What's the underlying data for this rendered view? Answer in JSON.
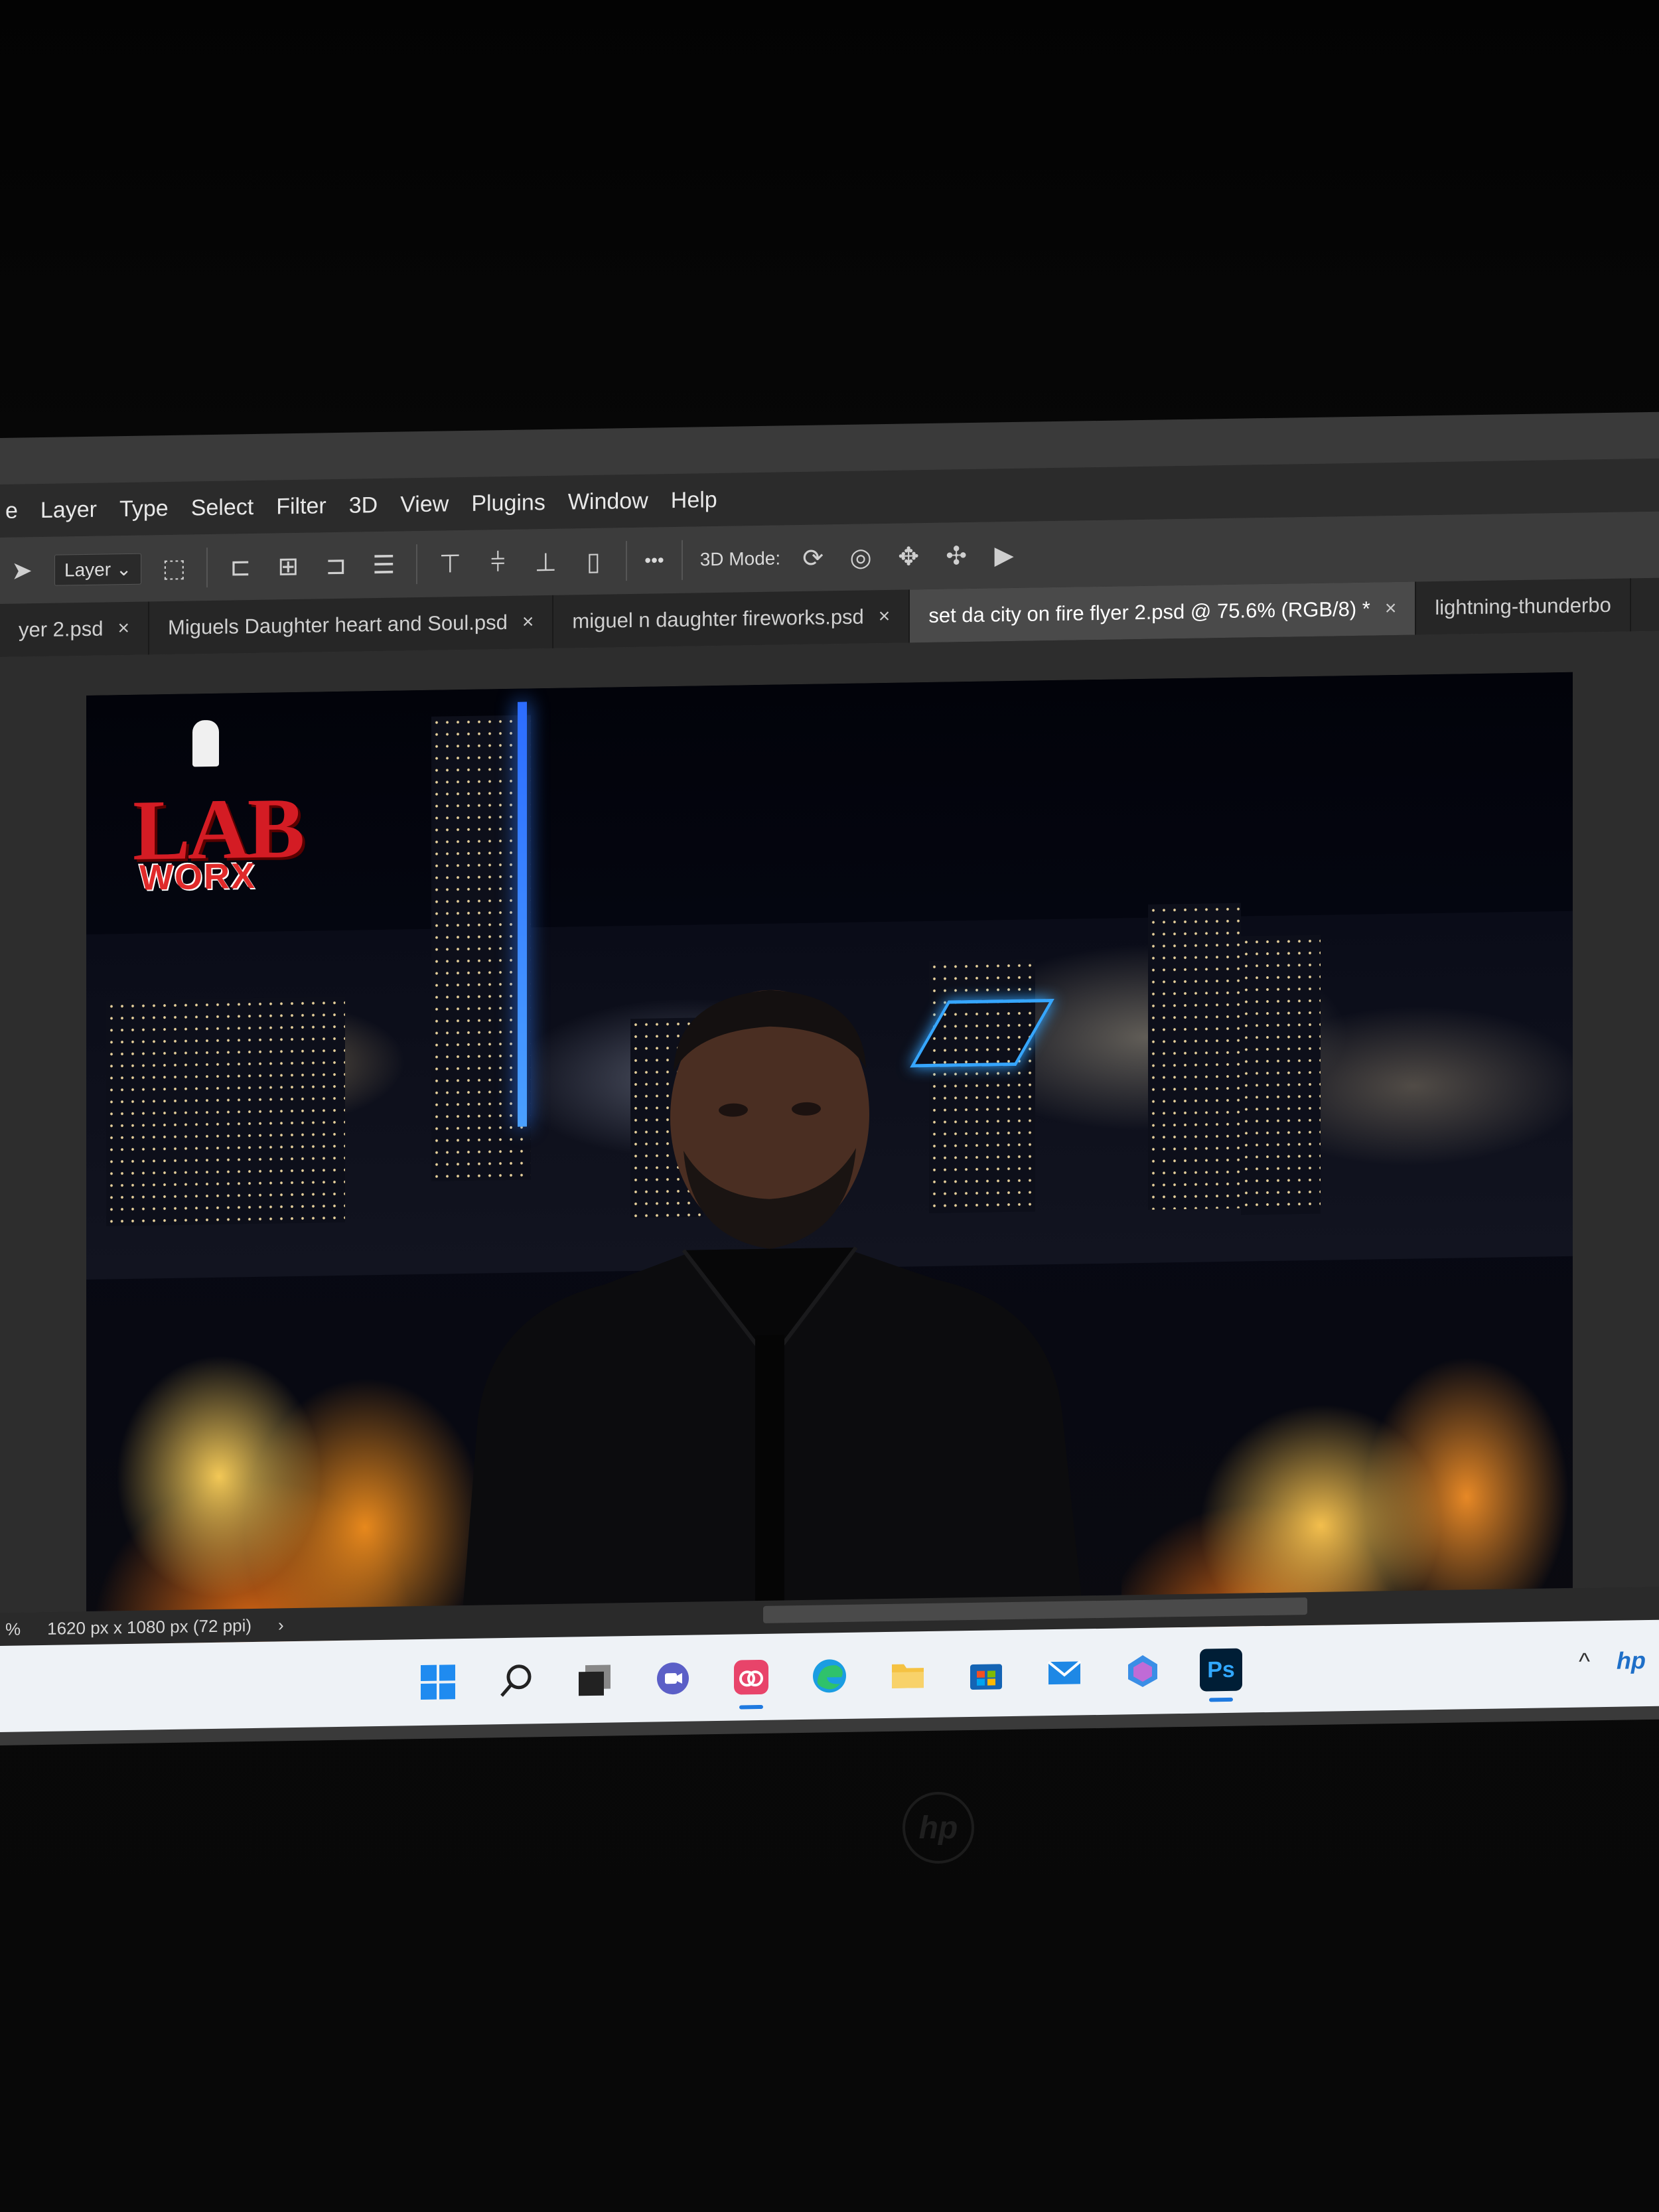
{
  "menu": [
    "e",
    "Layer",
    "Type",
    "Select",
    "Filter",
    "3D",
    "View",
    "Plugins",
    "Window",
    "Help"
  ],
  "options_bar": {
    "layer_select": "Layer",
    "more": "•••",
    "mode_label": "3D Mode:"
  },
  "tabs": [
    {
      "label": "yer 2.psd",
      "active": false
    },
    {
      "label": "Miguels Daughter heart and Soul.psd",
      "active": false
    },
    {
      "label": "miguel n daughter fireworks.psd",
      "active": false
    },
    {
      "label": "set da city on fire flyer 2.psd @ 75.6% (RGB/8) *",
      "active": true
    },
    {
      "label": "lightning-thunderbo",
      "active": false
    }
  ],
  "tab_close": "×",
  "canvas": {
    "logo_lab": "LAB",
    "logo_worx": "WORX"
  },
  "status_bar": {
    "zoom": "%",
    "doc_size": "1620 px x 1080 px (72 ppi)",
    "arrow": "›"
  },
  "taskbar": {
    "icons": [
      "windows-start",
      "search",
      "task-view",
      "chat",
      "creative-cloud",
      "edge",
      "file-explorer",
      "store",
      "mail",
      "copilot",
      "photoshop"
    ],
    "ps_label": "Ps",
    "tray_chevron": "^",
    "tray_brand": "hp"
  },
  "bezel_brand": "hp"
}
